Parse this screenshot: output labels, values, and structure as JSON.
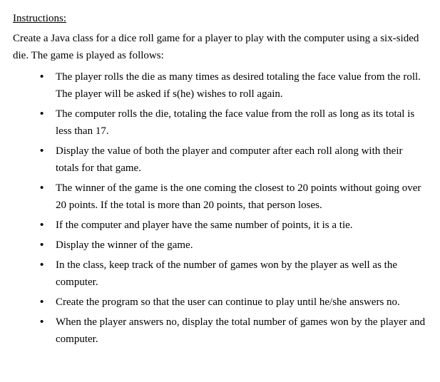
{
  "heading": "Instructions:",
  "intro": "Create a Java class for a dice roll game for a player to play with the computer using a six-sided die. The game is played as follows:",
  "bullets": [
    "The player rolls the die as many times as desired totaling the face value from the roll. The player will be asked if s(he) wishes to roll again.",
    "The computer rolls the die, totaling the face value from the roll as long as its total is less than 17.",
    "Display the value of both the player and computer after each roll along with their totals for that game.",
    "The winner of the game is the one coming the closest to 20 points without going over 20 points. If the total is more than 20 points, that person loses.",
    "If the computer and player have the same number of points, it is a tie.",
    "Display the winner of the game.",
    "In the class, keep track of the number of games won by the player as well as the computer.",
    "Create the program so that the user can continue to play until he/she answers no.",
    "When the player answers no, display the total number of games won by the player and computer."
  ]
}
